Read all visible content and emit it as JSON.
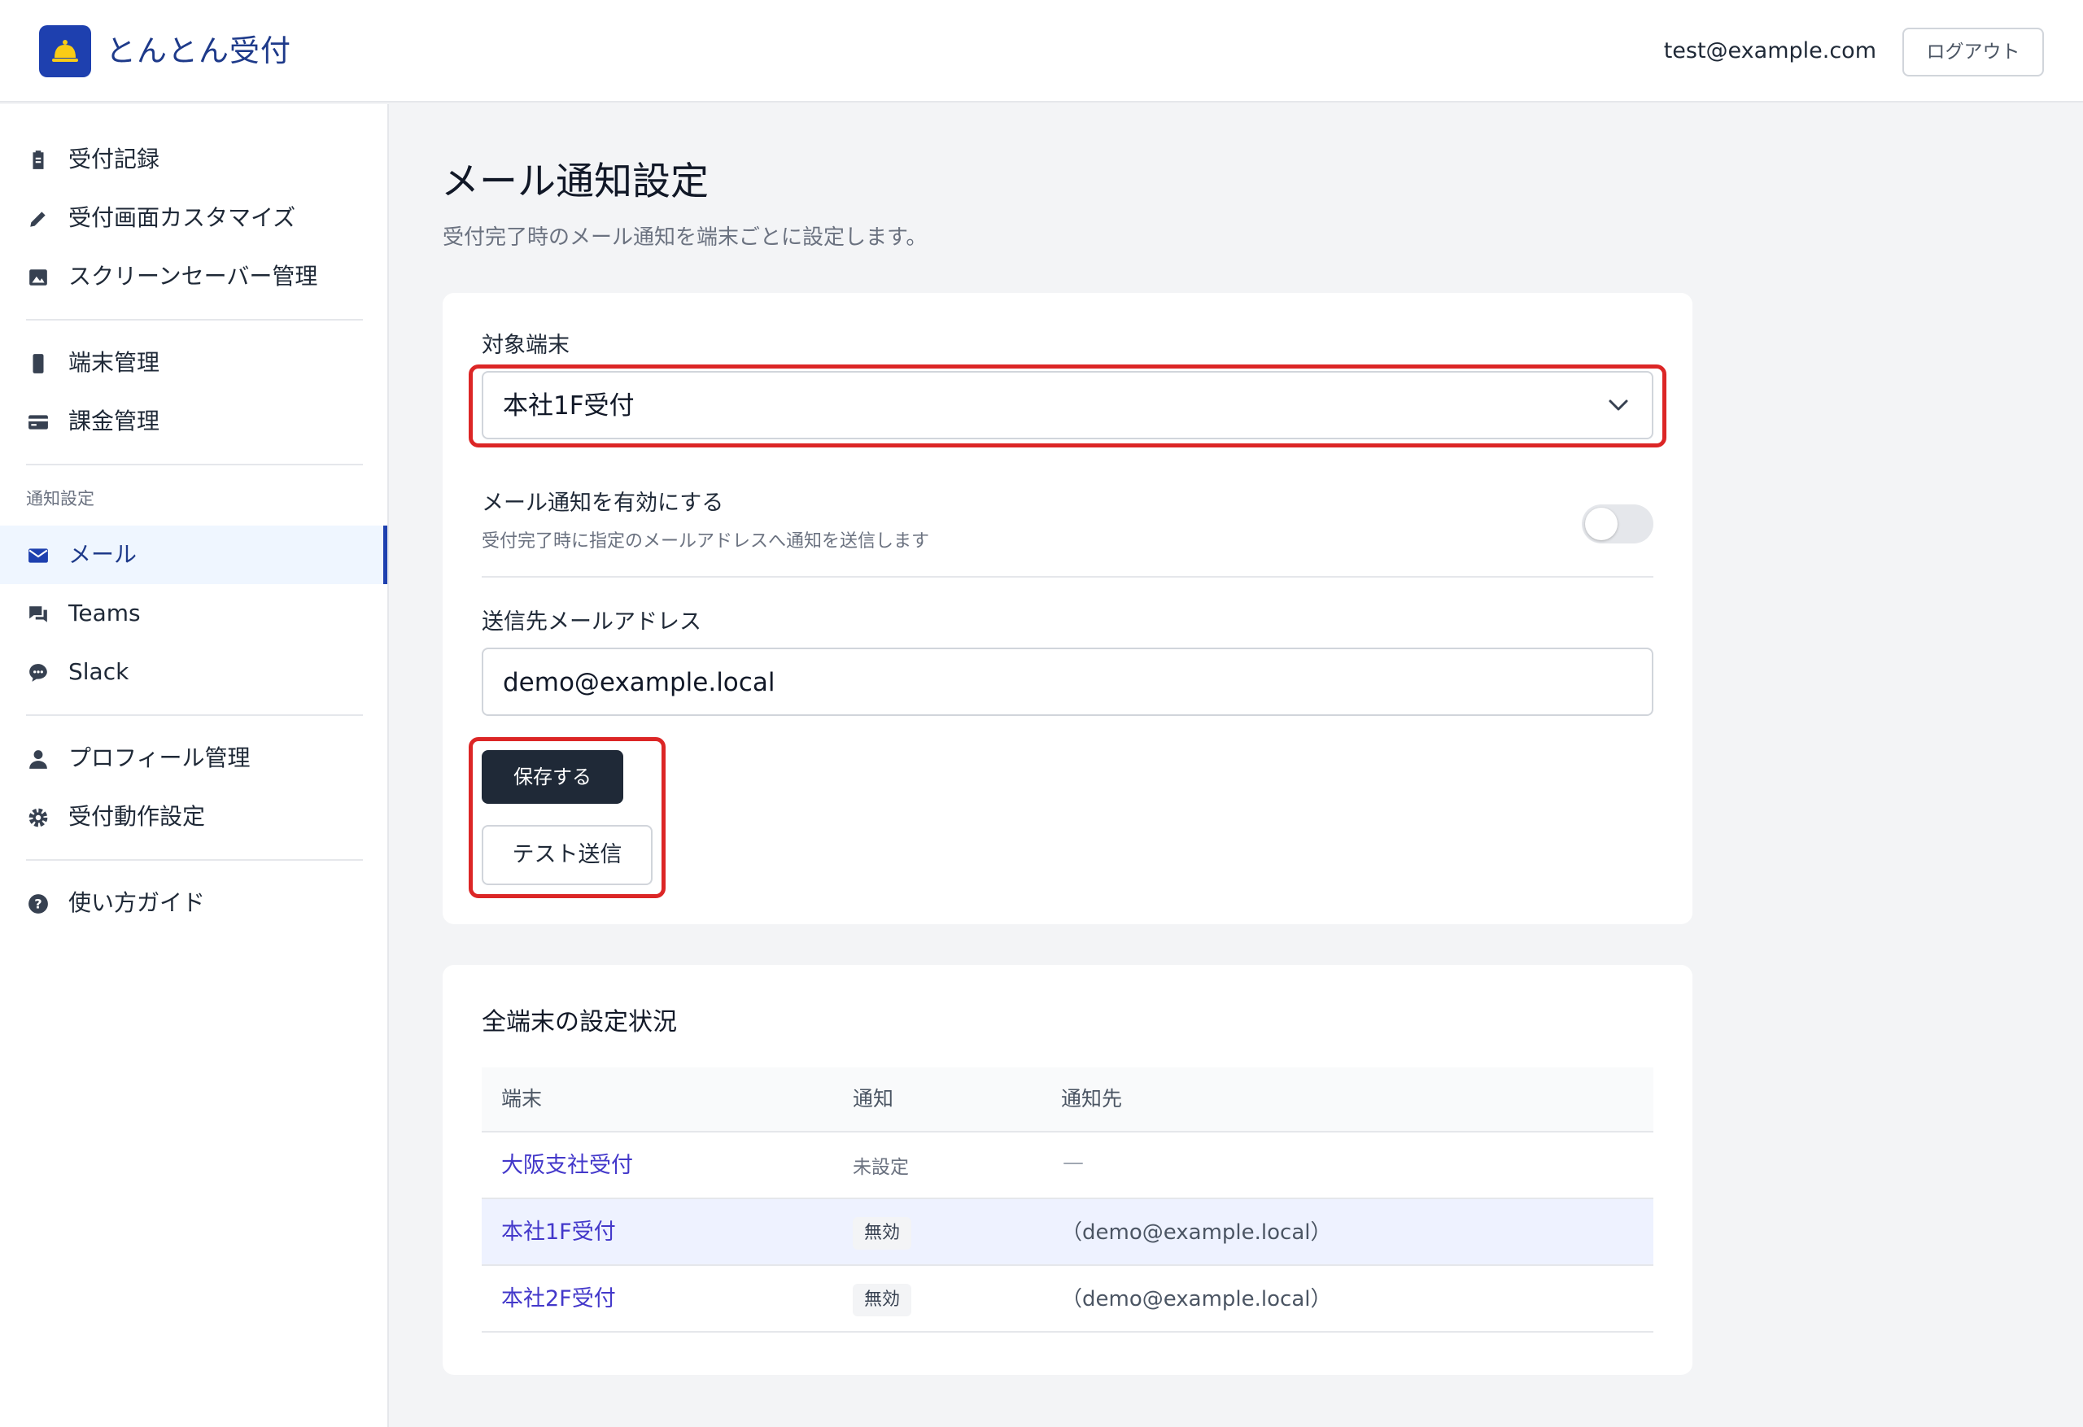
{
  "header": {
    "app_title": "とんとん受付",
    "user_email": "test@example.com",
    "logout_label": "ログアウト"
  },
  "sidebar": {
    "items": [
      {
        "label": "受付記録",
        "icon": "clipboard-icon"
      },
      {
        "label": "受付画面カスタマイズ",
        "icon": "pencil-icon"
      },
      {
        "label": "スクリーンセーバー管理",
        "icon": "image-icon"
      },
      {
        "label": "端末管理",
        "icon": "phone-icon"
      },
      {
        "label": "課金管理",
        "icon": "credit-card-icon"
      },
      {
        "label": "メール",
        "icon": "mail-icon",
        "active": true
      },
      {
        "label": "Teams",
        "icon": "chat-icon"
      },
      {
        "label": "Slack",
        "icon": "message-icon"
      },
      {
        "label": "プロフィール管理",
        "icon": "person-icon"
      },
      {
        "label": "受付動作設定",
        "icon": "gear-icon"
      },
      {
        "label": "使い方ガイド",
        "icon": "help-icon"
      }
    ],
    "section_label": "通知設定"
  },
  "main": {
    "title": "メール通知設定",
    "subtitle": "受付完了時のメール通知を端末ごとに設定します。",
    "form": {
      "device_label": "対象端末",
      "device_selected": "本社1F受付",
      "toggle_title": "メール通知を有効にする",
      "toggle_desc": "受付完了時に指定のメールアドレスへ通知を送信します",
      "toggle_on": false,
      "email_label": "送信先メールアドレス",
      "email_value": "demo@example.local",
      "save_label": "保存する",
      "test_label": "テスト送信"
    },
    "status": {
      "title": "全端末の設定状況",
      "columns": [
        "端末",
        "通知",
        "通知先"
      ],
      "rows": [
        {
          "device": "大阪支社受付",
          "status": "未設定",
          "dest": "—"
        },
        {
          "device": "本社1F受付",
          "status": "無効",
          "dest": "（demo@example.local）"
        },
        {
          "device": "本社2F受付",
          "status": "無効",
          "dest": "（demo@example.local）"
        }
      ]
    }
  },
  "colors": {
    "brand": "#1e40af",
    "highlight": "#dc2626",
    "primary_button": "#1f2937",
    "link": "#4338ca"
  }
}
